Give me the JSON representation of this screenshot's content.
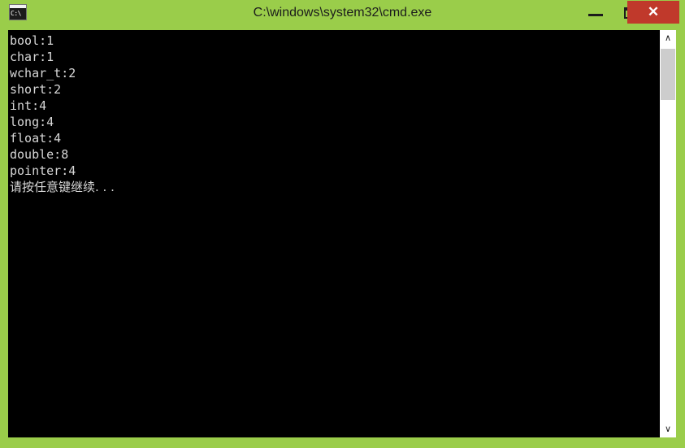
{
  "window": {
    "title": "C:\\windows\\system32\\cmd.exe",
    "icon_name": "cmd-console-icon",
    "icon_glyph": "C:\\",
    "chrome_color": "#9ACD4A",
    "console_bg": "#000000",
    "console_fg": "#D8D8D8",
    "close_button_color": "#C0392B"
  },
  "controls": {
    "minimize_label": "–",
    "maximize_label": "❐",
    "close_label": "✕"
  },
  "console": {
    "lines": [
      "bool:1",
      "char:1",
      "wchar_t:2",
      "short:2",
      "int:4",
      "long:4",
      "float:4",
      "double:8",
      "pointer:4",
      "请按任意键继续. . ."
    ]
  },
  "scrollbar": {
    "up_arrow": "∧",
    "down_arrow": "∨",
    "thumb_position_percent": 0
  }
}
